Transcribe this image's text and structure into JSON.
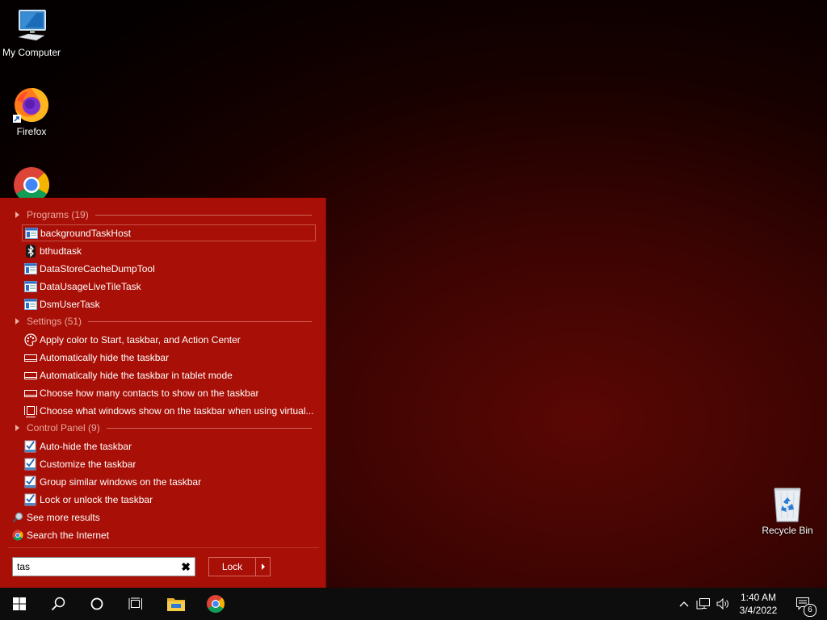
{
  "desktop": {
    "icons": [
      {
        "label": "My Computer"
      },
      {
        "label": "Firefox"
      },
      {
        "label": ""
      },
      {
        "label": "Recycle Bin"
      }
    ]
  },
  "start_menu": {
    "groups": {
      "programs": {
        "title": "Programs (19)"
      },
      "settings": {
        "title": "Settings (51)"
      },
      "control_panel": {
        "title": "Control Panel (9)"
      }
    },
    "programs": [
      {
        "label": "backgroundTaskHost",
        "icon": "app-window-icon"
      },
      {
        "label": "bthudtask",
        "icon": "bluetooth-icon"
      },
      {
        "label": "DataStoreCacheDumpTool",
        "icon": "app-window-icon"
      },
      {
        "label": "DataUsageLiveTileTask",
        "icon": "app-window-icon"
      },
      {
        "label": "DsmUserTask",
        "icon": "app-window-icon"
      }
    ],
    "settings": [
      {
        "label": "Apply color to Start, taskbar, and Action Center",
        "icon": "palette-icon"
      },
      {
        "label": "Automatically hide the taskbar",
        "icon": "taskbar-icon"
      },
      {
        "label": "Automatically hide the taskbar in tablet mode",
        "icon": "taskbar-icon"
      },
      {
        "label": "Choose how many contacts to show on the taskbar",
        "icon": "taskbar-icon"
      },
      {
        "label": "Choose what windows show on the taskbar when using virtual...",
        "icon": "virtual-desktop-icon"
      }
    ],
    "control_panel": [
      {
        "label": "Auto-hide the taskbar",
        "icon": "checklist-icon"
      },
      {
        "label": "Customize the taskbar",
        "icon": "checklist-icon"
      },
      {
        "label": "Group similar windows on the taskbar",
        "icon": "checklist-icon"
      },
      {
        "label": "Lock or unlock the taskbar",
        "icon": "checklist-icon"
      }
    ],
    "see_more": "See more results",
    "search_internet": "Search the Internet",
    "search": {
      "value": "tas",
      "clear_glyph": "✖"
    },
    "lock_button": {
      "label": "Lock"
    }
  },
  "taskbar": {
    "items": [
      "start-icon",
      "search-icon",
      "cortana-icon",
      "task-view-icon",
      "file-explorer-icon",
      "chrome-icon"
    ],
    "clock": {
      "time": "1:40 AM",
      "date": "3/4/2022"
    },
    "notifications": {
      "count": "6"
    }
  },
  "colors": {
    "menu_background": "#a80f06",
    "group_header_text": "#e8a79f",
    "taskbar": "#0d0d0d"
  }
}
